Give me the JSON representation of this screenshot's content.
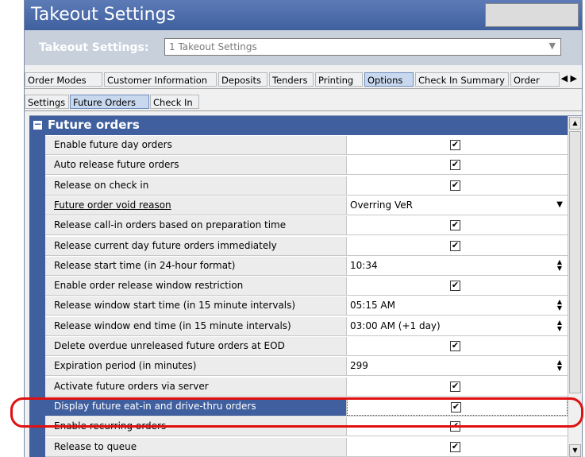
{
  "window": {
    "title": "Takeout Settings"
  },
  "selector": {
    "label": "Takeout Settings:",
    "value": "1 Takeout Settings"
  },
  "tabs_primary": [
    "Order Modes",
    "Customer Information",
    "Deposits",
    "Tenders",
    "Printing",
    "Options",
    "Check In Summary",
    "Order"
  ],
  "tabs_primary_active": "Options",
  "tabs_secondary": [
    "Settings",
    "Future Orders",
    "Check In"
  ],
  "tabs_secondary_active": "Future Orders",
  "section": {
    "title": "Future orders",
    "toggle": "−"
  },
  "rows": [
    {
      "label": "Enable future day orders",
      "type": "checkbox",
      "checked": true
    },
    {
      "label": "Auto release future orders",
      "type": "checkbox",
      "checked": true
    },
    {
      "label": "Release on check in",
      "type": "checkbox",
      "checked": true
    },
    {
      "label": "Future order void reason",
      "type": "dropdown",
      "value": "Overring VeR"
    },
    {
      "label": "Release call-in orders based on preparation time",
      "type": "checkbox",
      "checked": true
    },
    {
      "label": "Release current day future orders immediately",
      "type": "checkbox",
      "checked": true
    },
    {
      "label": "Release start time (in 24-hour format)",
      "type": "spinner",
      "value": "10:34"
    },
    {
      "label": "Enable order release window restriction",
      "type": "checkbox",
      "checked": true
    },
    {
      "label": "Release window start time (in 15 minute intervals)",
      "type": "spinner",
      "value": "05:15 AM"
    },
    {
      "label": "Release window end time (in 15 minute intervals)",
      "type": "spinner",
      "value": "03:00 AM (+1 day)"
    },
    {
      "label": "Delete overdue unreleased future orders at EOD",
      "type": "checkbox",
      "checked": true
    },
    {
      "label": "Expiration period (in minutes)",
      "type": "spinner",
      "value": "299"
    },
    {
      "label": "Activate future orders via server",
      "type": "checkbox",
      "checked": true
    },
    {
      "label": "Display future eat-in and drive-thru orders",
      "type": "checkbox",
      "checked": true
    },
    {
      "label": "Enable recurring orders",
      "type": "checkbox",
      "checked": true
    },
    {
      "label": "Release to queue",
      "type": "checkbox",
      "checked": true
    }
  ],
  "selected_row": "Display future eat-in and drive-thru orders",
  "icons": {
    "checkbox": "✔",
    "dropdown": "▼",
    "spin": "▲▼",
    "tab_left": "◀",
    "tab_right": "▶"
  },
  "colors": {
    "header_blue": "#3f5f9f",
    "highlight_red": "#e01010"
  }
}
